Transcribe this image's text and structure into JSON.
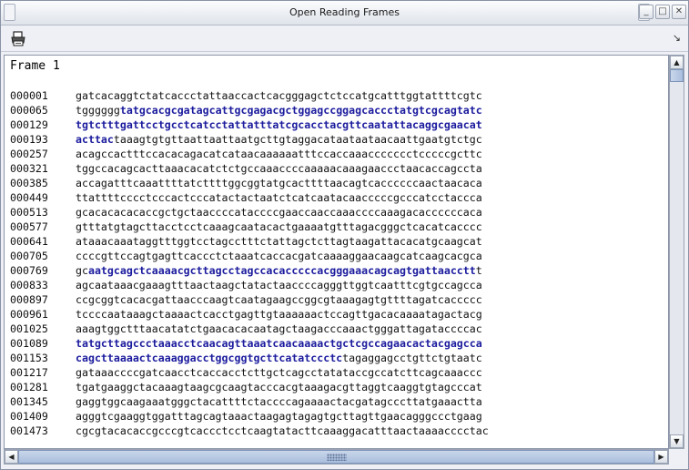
{
  "window": {
    "title": "Open Reading Frames",
    "minimize_glyph": "_",
    "maximize_glyph": "□",
    "close_glyph": "✕"
  },
  "toolbar": {
    "print_icon": "printer-icon",
    "corner_arrow": "↘"
  },
  "content": {
    "frame_label": "Frame 1",
    "rows": [
      {
        "num": "000001",
        "segs": [
          {
            "t": "gatcacaggtctatcaccctattaaccactcacgggagctctccatgcatttggtattttcgtc",
            "orf": false
          }
        ]
      },
      {
        "num": "000065",
        "segs": [
          {
            "t": "tgggggg",
            "orf": false
          },
          {
            "t": "tatgcacgcgatagcattgcgagacgctggagccggagcaccctatgtcgcagtatc",
            "orf": true
          }
        ]
      },
      {
        "num": "000129",
        "segs": [
          {
            "t": "tgtctttgattcctgcctcatcctattatttatcgcacctacgttcaatattacaggcgaacat",
            "orf": true
          }
        ]
      },
      {
        "num": "000193",
        "segs": [
          {
            "t": "acttac",
            "orf": true
          },
          {
            "t": "taaagtgtgttaattaattaatgcttgtaggacataataataacaattgaatgtctgc",
            "orf": false
          }
        ]
      },
      {
        "num": "000257",
        "segs": [
          {
            "t": "acagccactttccacacagacatcataacaaaaaatttccaccaaaccccccctcccccgcttc",
            "orf": false
          }
        ]
      },
      {
        "num": "000321",
        "segs": [
          {
            "t": "tggccacagcacttaaacacatctctgccaaaccccaaaaacaaagaaccctaacaccagccta",
            "orf": false
          }
        ]
      },
      {
        "num": "000385",
        "segs": [
          {
            "t": "accagatttcaaattttatcttttggcggtatgcacttttaacagtcaccccccaactaacaca",
            "orf": false
          }
        ]
      },
      {
        "num": "000449",
        "segs": [
          {
            "t": "ttattttcccctcccactcccatactactaatctcatcaatacaacccccgcccatcctaccca",
            "orf": false
          }
        ]
      },
      {
        "num": "000513",
        "segs": [
          {
            "t": "gcacacacacaccgctgctaaccccataccccgaaccaaccaaaccccaaagacaccccccaca",
            "orf": false
          }
        ]
      },
      {
        "num": "000577",
        "segs": [
          {
            "t": "gtttatgtagcttacctcctcaaagcaatacactgaaaatgtttagacgggctcacatcacccc",
            "orf": false
          }
        ]
      },
      {
        "num": "000641",
        "segs": [
          {
            "t": "ataaacaaataggtttggtcctagcctttctattagctcttagtaagattacacatgcaagcat",
            "orf": false
          }
        ]
      },
      {
        "num": "000705",
        "segs": [
          {
            "t": "ccccgttccagtgagttcaccctctaaatcaccacgatcaaaaggaacaagcatcaagcacgca",
            "orf": false
          }
        ]
      },
      {
        "num": "000769",
        "segs": [
          {
            "t": "gc",
            "orf": false
          },
          {
            "t": "aatgcagctcaaaacgcttagcctagccacacccccacgggaaacagcagtgattaacctt",
            "orf": true
          },
          {
            "t": "t",
            "orf": false
          }
        ]
      },
      {
        "num": "000833",
        "segs": [
          {
            "t": "agcaataaacgaaagtttaactaagctatactaaccccagggttggtcaatttcgtgccagcca",
            "orf": false
          }
        ]
      },
      {
        "num": "000897",
        "segs": [
          {
            "t": "ccgcggtcacacgattaacccaagtcaatagaagccggcgtaaagagtgttttagatcaccccc",
            "orf": false
          }
        ]
      },
      {
        "num": "000961",
        "segs": [
          {
            "t": "tccccaataaagctaaaactcacctgagttgtaaaaaactccagttgacacaaaatagactacg",
            "orf": false
          }
        ]
      },
      {
        "num": "001025",
        "segs": [
          {
            "t": "aaagtggctttaacatatctgaacacacaatagctaagacccaaactgggattagataccccac",
            "orf": false
          }
        ]
      },
      {
        "num": "001089",
        "segs": [
          {
            "t": "tatgcttagccctaaacctcaacagttaaatcaacaaaactgctcgccagaacactacgagcca",
            "orf": true
          }
        ]
      },
      {
        "num": "001153",
        "segs": [
          {
            "t": "cagcttaaaactcaaaggacctggcggtgcttcatatccctc",
            "orf": true
          },
          {
            "t": "tagaggagcctgttctgtaatc",
            "orf": false
          }
        ]
      },
      {
        "num": "001217",
        "segs": [
          {
            "t": "gataaaccccgatcaacctcaccacctcttgctcagcctatataccgccatcttcagcaaaccc",
            "orf": false
          }
        ]
      },
      {
        "num": "001281",
        "segs": [
          {
            "t": "tgatgaaggctacaaagtaagcgcaagtacccacgtaaagacgttaggtcaaggtgtagcccat",
            "orf": false
          }
        ]
      },
      {
        "num": "001345",
        "segs": [
          {
            "t": "gaggtggcaagaaatgggctacattttctaccccagaaaactacgatagcccttatgaaactta",
            "orf": false
          }
        ]
      },
      {
        "num": "001409",
        "segs": [
          {
            "t": "agggtcgaaggtggatttagcagtaaactaagagtagagtgcttagttgaacagggccctgaag",
            "orf": false
          }
        ]
      },
      {
        "num": "001473",
        "segs": [
          {
            "t": "cgcgtacacaccgcccgtcaccctcctcaagtatacttcaaaggacatttaactaaaacccctac",
            "orf": false
          }
        ]
      }
    ]
  },
  "colors": {
    "orf": "#1b1b9e",
    "text": "#111111"
  }
}
